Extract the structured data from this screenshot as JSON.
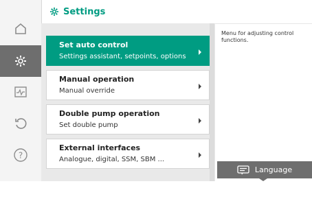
{
  "header": {
    "title": "Settings",
    "icon": "gear-icon"
  },
  "rail": {
    "items": [
      {
        "name": "home-icon"
      },
      {
        "name": "gear-icon",
        "active": true
      },
      {
        "name": "diagnostics-icon"
      },
      {
        "name": "restore-icon"
      },
      {
        "name": "help-icon"
      }
    ]
  },
  "menu": {
    "items": [
      {
        "title": "Set auto control",
        "subtitle": "Settings assistant, setpoints, options",
        "active": true
      },
      {
        "title": "Manual operation",
        "subtitle": "Manual override",
        "active": false
      },
      {
        "title": "Double pump operation",
        "subtitle": "Set double pump",
        "active": false
      },
      {
        "title": "External interfaces",
        "subtitle": "Analogue, digital, SSM, SBM ...",
        "active": false
      }
    ]
  },
  "help": {
    "text": "Menu for adjusting control functions."
  },
  "context": {
    "label": "Language",
    "icon": "language-icon"
  },
  "colors": {
    "accent": "#009c82",
    "rail_active": "#6e6e6e"
  }
}
